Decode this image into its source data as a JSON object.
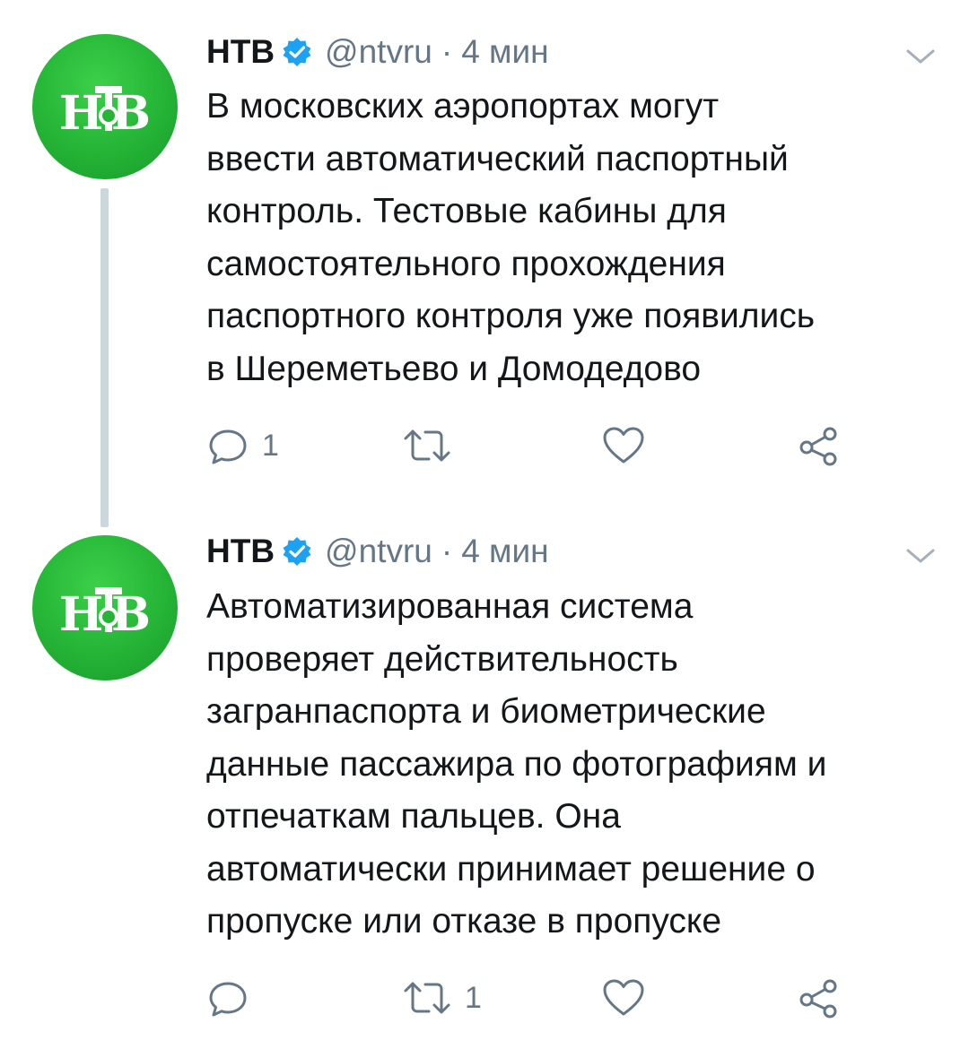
{
  "colors": {
    "avatar_green": "#25b436",
    "verified_blue": "#1da1f2",
    "secondary_text": "#657786",
    "thread_line": "#ccd6dd"
  },
  "tweets": [
    {
      "author_name": "НТВ",
      "handle": "@ntvru",
      "separator": "·",
      "time": "4 мин",
      "avatar_icon": "ntv-logo",
      "text_lines": [
        "В московских аэропортах могут",
        "ввести автоматический паспортный",
        "контроль. Тестовые кабины для",
        "самостоятельного прохождения",
        "паспортного контроля уже появились",
        "в Шереметьево и Домодедово"
      ],
      "reply_count": "1",
      "retweet_count": "",
      "like_count": ""
    },
    {
      "author_name": "НТВ",
      "handle": "@ntvru",
      "separator": "·",
      "time": "4 мин",
      "avatar_icon": "ntv-logo",
      "text_lines": [
        "Автоматизированная система",
        "проверяет действительность",
        "загранпаспорта и биометрические",
        "данные пассажира по фотографиям и",
        "отпечаткам пальцев. Она",
        "автоматически принимает решение о",
        "пропуске или отказе в пропуске"
      ],
      "reply_count": "",
      "retweet_count": "1",
      "like_count": ""
    }
  ]
}
